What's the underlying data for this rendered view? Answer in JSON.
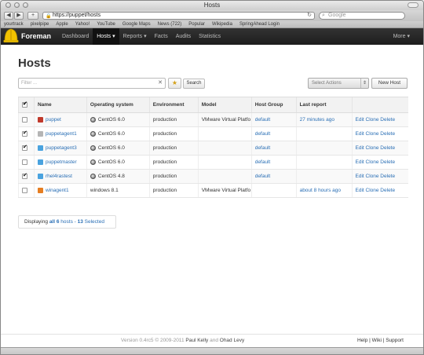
{
  "window": {
    "title": "Hosts"
  },
  "toolbar": {
    "url": "https://puppet/hosts",
    "search_placeholder": "Google",
    "back": "◀",
    "forward": "▶",
    "add": "+"
  },
  "bookmarks": [
    "yourtrack",
    "pixelpipe",
    "Apple",
    "Yahoo!",
    "YouTube",
    "Google Maps",
    "News (722)",
    "Popular",
    "Wikipedia",
    "SpringAhead Login"
  ],
  "navbar": {
    "brand": "Foreman",
    "items": [
      "Dashboard",
      "Hosts ▾",
      "Reports ▾",
      "Facts",
      "Audits",
      "Statistics"
    ],
    "more": "More ▾"
  },
  "page": {
    "title": "Hosts",
    "filter_placeholder": "Filter ...",
    "filter_clear": "✕",
    "bookmark_icon": "★",
    "search_label": "Search",
    "select_actions": "Select Actions",
    "new_host": "New Host"
  },
  "table": {
    "headers": [
      "Name",
      "Operating system",
      "Environment",
      "Model",
      "Host Group",
      "Last report",
      ""
    ],
    "rows": [
      {
        "checked": false,
        "icon_color": "#c0392b",
        "name": "puppet",
        "os": "CentOS 6.0",
        "os_icon": "centos",
        "env": "production",
        "model": "VMware Virtual Platfo",
        "group": "default",
        "report": "27 minutes ago",
        "actions": "Edit Clone Delete"
      },
      {
        "checked": true,
        "icon_color": "#b5b5b5",
        "name": "puppetagent1",
        "os": "CentOS 6.0",
        "os_icon": "centos",
        "env": "production",
        "model": "",
        "group": "default",
        "report": "",
        "actions": "Edit Clone Delete"
      },
      {
        "checked": true,
        "icon_color": "#4aa3df",
        "name": "puppetagent3",
        "os": "CentOS 6.0",
        "os_icon": "centos",
        "env": "production",
        "model": "",
        "group": "default",
        "report": "",
        "actions": "Edit Clone Delete"
      },
      {
        "checked": false,
        "icon_color": "#4aa3df",
        "name": "puppetmaster",
        "os": "CentOS 6.0",
        "os_icon": "centos",
        "env": "production",
        "model": "",
        "group": "default",
        "report": "",
        "actions": "Edit Clone Delete"
      },
      {
        "checked": true,
        "icon_color": "#4aa3df",
        "name": "rhel4rastest",
        "os": "CentOS 4.8",
        "os_icon": "centos",
        "env": "production",
        "model": "",
        "group": "default",
        "report": "",
        "actions": "Edit Clone Delete"
      },
      {
        "checked": false,
        "icon_color": "#e67e22",
        "name": "winagent1",
        "os": "windows 8.1",
        "os_icon": "",
        "env": "production",
        "model": "VMware Virtual Platfo",
        "group": "",
        "report": "about 8 hours ago",
        "actions": "Edit Clone Delete"
      }
    ]
  },
  "status": {
    "prefix": "Displaying",
    "all": "all 6",
    "mid": "hosts -",
    "selected": "13",
    "suffix": "Selected"
  },
  "footer": {
    "version": "Version 0.4rc5 © 2009-2011",
    "author1": "Paul Kelly",
    "and": "and",
    "author2": "Ohad Levy",
    "links": "Help | Wiki | Support"
  }
}
